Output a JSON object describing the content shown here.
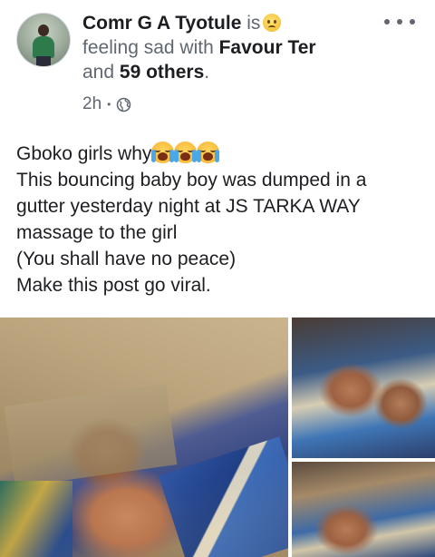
{
  "post": {
    "author": "Comr G A Tyotule",
    "is_word": "is",
    "feeling_text": "feeling sad with",
    "tagged_user": "Favour Ter",
    "and_word": "and",
    "others": "59 others",
    "period": ".",
    "time": "2h",
    "separator": "•",
    "privacy_icon": "globe-icon",
    "feeling_icon": "sad-face-emoji"
  },
  "body": {
    "line1_text": "Gboko girls why",
    "line1_emoji": "loudly-crying-face-emoji x3",
    "line2": "This bouncing baby boy was dumped in a",
    "line3": "gutter yesterday night at JS TARKA WAY",
    "line4": "massage to the girl",
    "line5": "(You shall have no peace)",
    "line6": "Make this post go viral."
  },
  "photos": {
    "count": 3
  },
  "colors": {
    "text_primary": "#1c1e21",
    "text_secondary": "#606770",
    "background": "#ffffff"
  }
}
